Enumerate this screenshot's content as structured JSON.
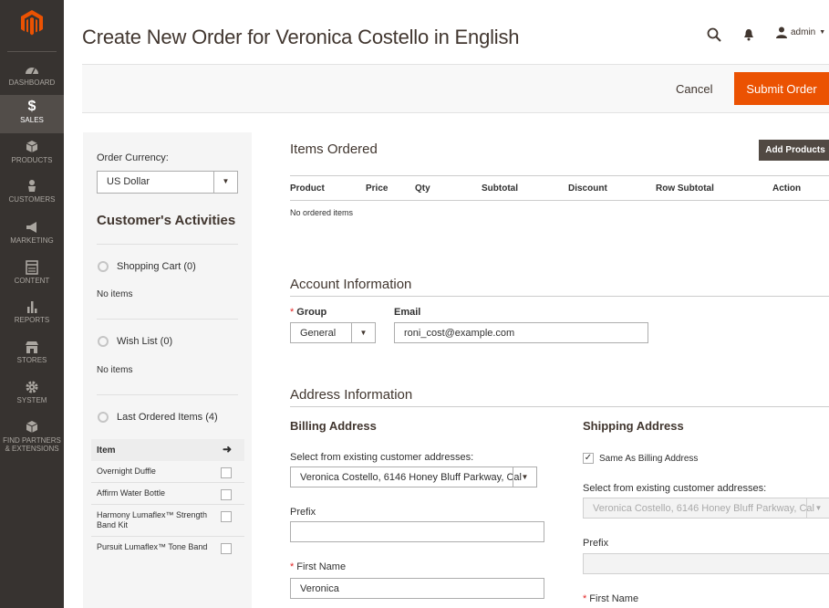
{
  "sidebar": {
    "items": [
      {
        "label": "DASHBOARD",
        "icon": "dashboard-icon"
      },
      {
        "label": "SALES",
        "icon": "dollar-icon",
        "active": true
      },
      {
        "label": "PRODUCTS",
        "icon": "cube-icon"
      },
      {
        "label": "CUSTOMERS",
        "icon": "person-icon"
      },
      {
        "label": "MARKETING",
        "icon": "megaphone-icon"
      },
      {
        "label": "CONTENT",
        "icon": "layout-icon"
      },
      {
        "label": "REPORTS",
        "icon": "bar-chart-icon"
      },
      {
        "label": "STORES",
        "icon": "store-icon"
      },
      {
        "label": "SYSTEM",
        "icon": "gear-icon"
      },
      {
        "label": "FIND PARTNERS & EXTENSIONS",
        "icon": "box-icon"
      }
    ]
  },
  "header": {
    "title": "Create New Order for Veronica Costello in English",
    "user": "admin"
  },
  "actions": {
    "cancel": "Cancel",
    "submit": "Submit Order"
  },
  "activities": {
    "currency_label": "Order Currency:",
    "currency_value": "US Dollar",
    "title": "Customer's Activities",
    "shopping_cart": "Shopping Cart (0)",
    "shopping_cart_empty": "No items",
    "wish_list": "Wish List (0)",
    "wish_list_empty": "No items",
    "last_ordered": "Last Ordered Items (4)",
    "item_header": "Item",
    "items": [
      "Overnight Duffle",
      "Affirm Water Bottle",
      "Harmony Lumaflex™ Strength Band Kit",
      "Pursuit Lumaflex™ Tone Band"
    ]
  },
  "items_ordered": {
    "title": "Items Ordered",
    "add_button": "Add Products",
    "columns": [
      "Product",
      "Price",
      "Qty",
      "Subtotal",
      "Discount",
      "Row Subtotal",
      "Action"
    ],
    "empty": "No ordered items"
  },
  "account": {
    "title": "Account Information",
    "group_label": "Group",
    "group_value": "General",
    "email_label": "Email",
    "email_value": "roni_cost@example.com"
  },
  "address": {
    "title": "Address Information",
    "billing": {
      "title": "Billing Address",
      "select_label": "Select from existing customer addresses:",
      "select_value": "Veronica Costello, 6146 Honey Bluff Parkway, Cal",
      "prefix_label": "Prefix",
      "prefix_value": "",
      "first_name_label": "First Name",
      "first_name_value": "Veronica"
    },
    "shipping": {
      "title": "Shipping Address",
      "same_as_billing": "Same As Billing Address",
      "same_checked": true,
      "select_label": "Select from existing customer addresses:",
      "select_value": "Veronica Costello, 6146 Honey Bluff Parkway, Cal",
      "prefix_label": "Prefix",
      "first_name_label": "First Name"
    }
  },
  "colors": {
    "sidebar_bg": "#373330",
    "accent": "#eb5202",
    "dark_button": "#514943"
  }
}
